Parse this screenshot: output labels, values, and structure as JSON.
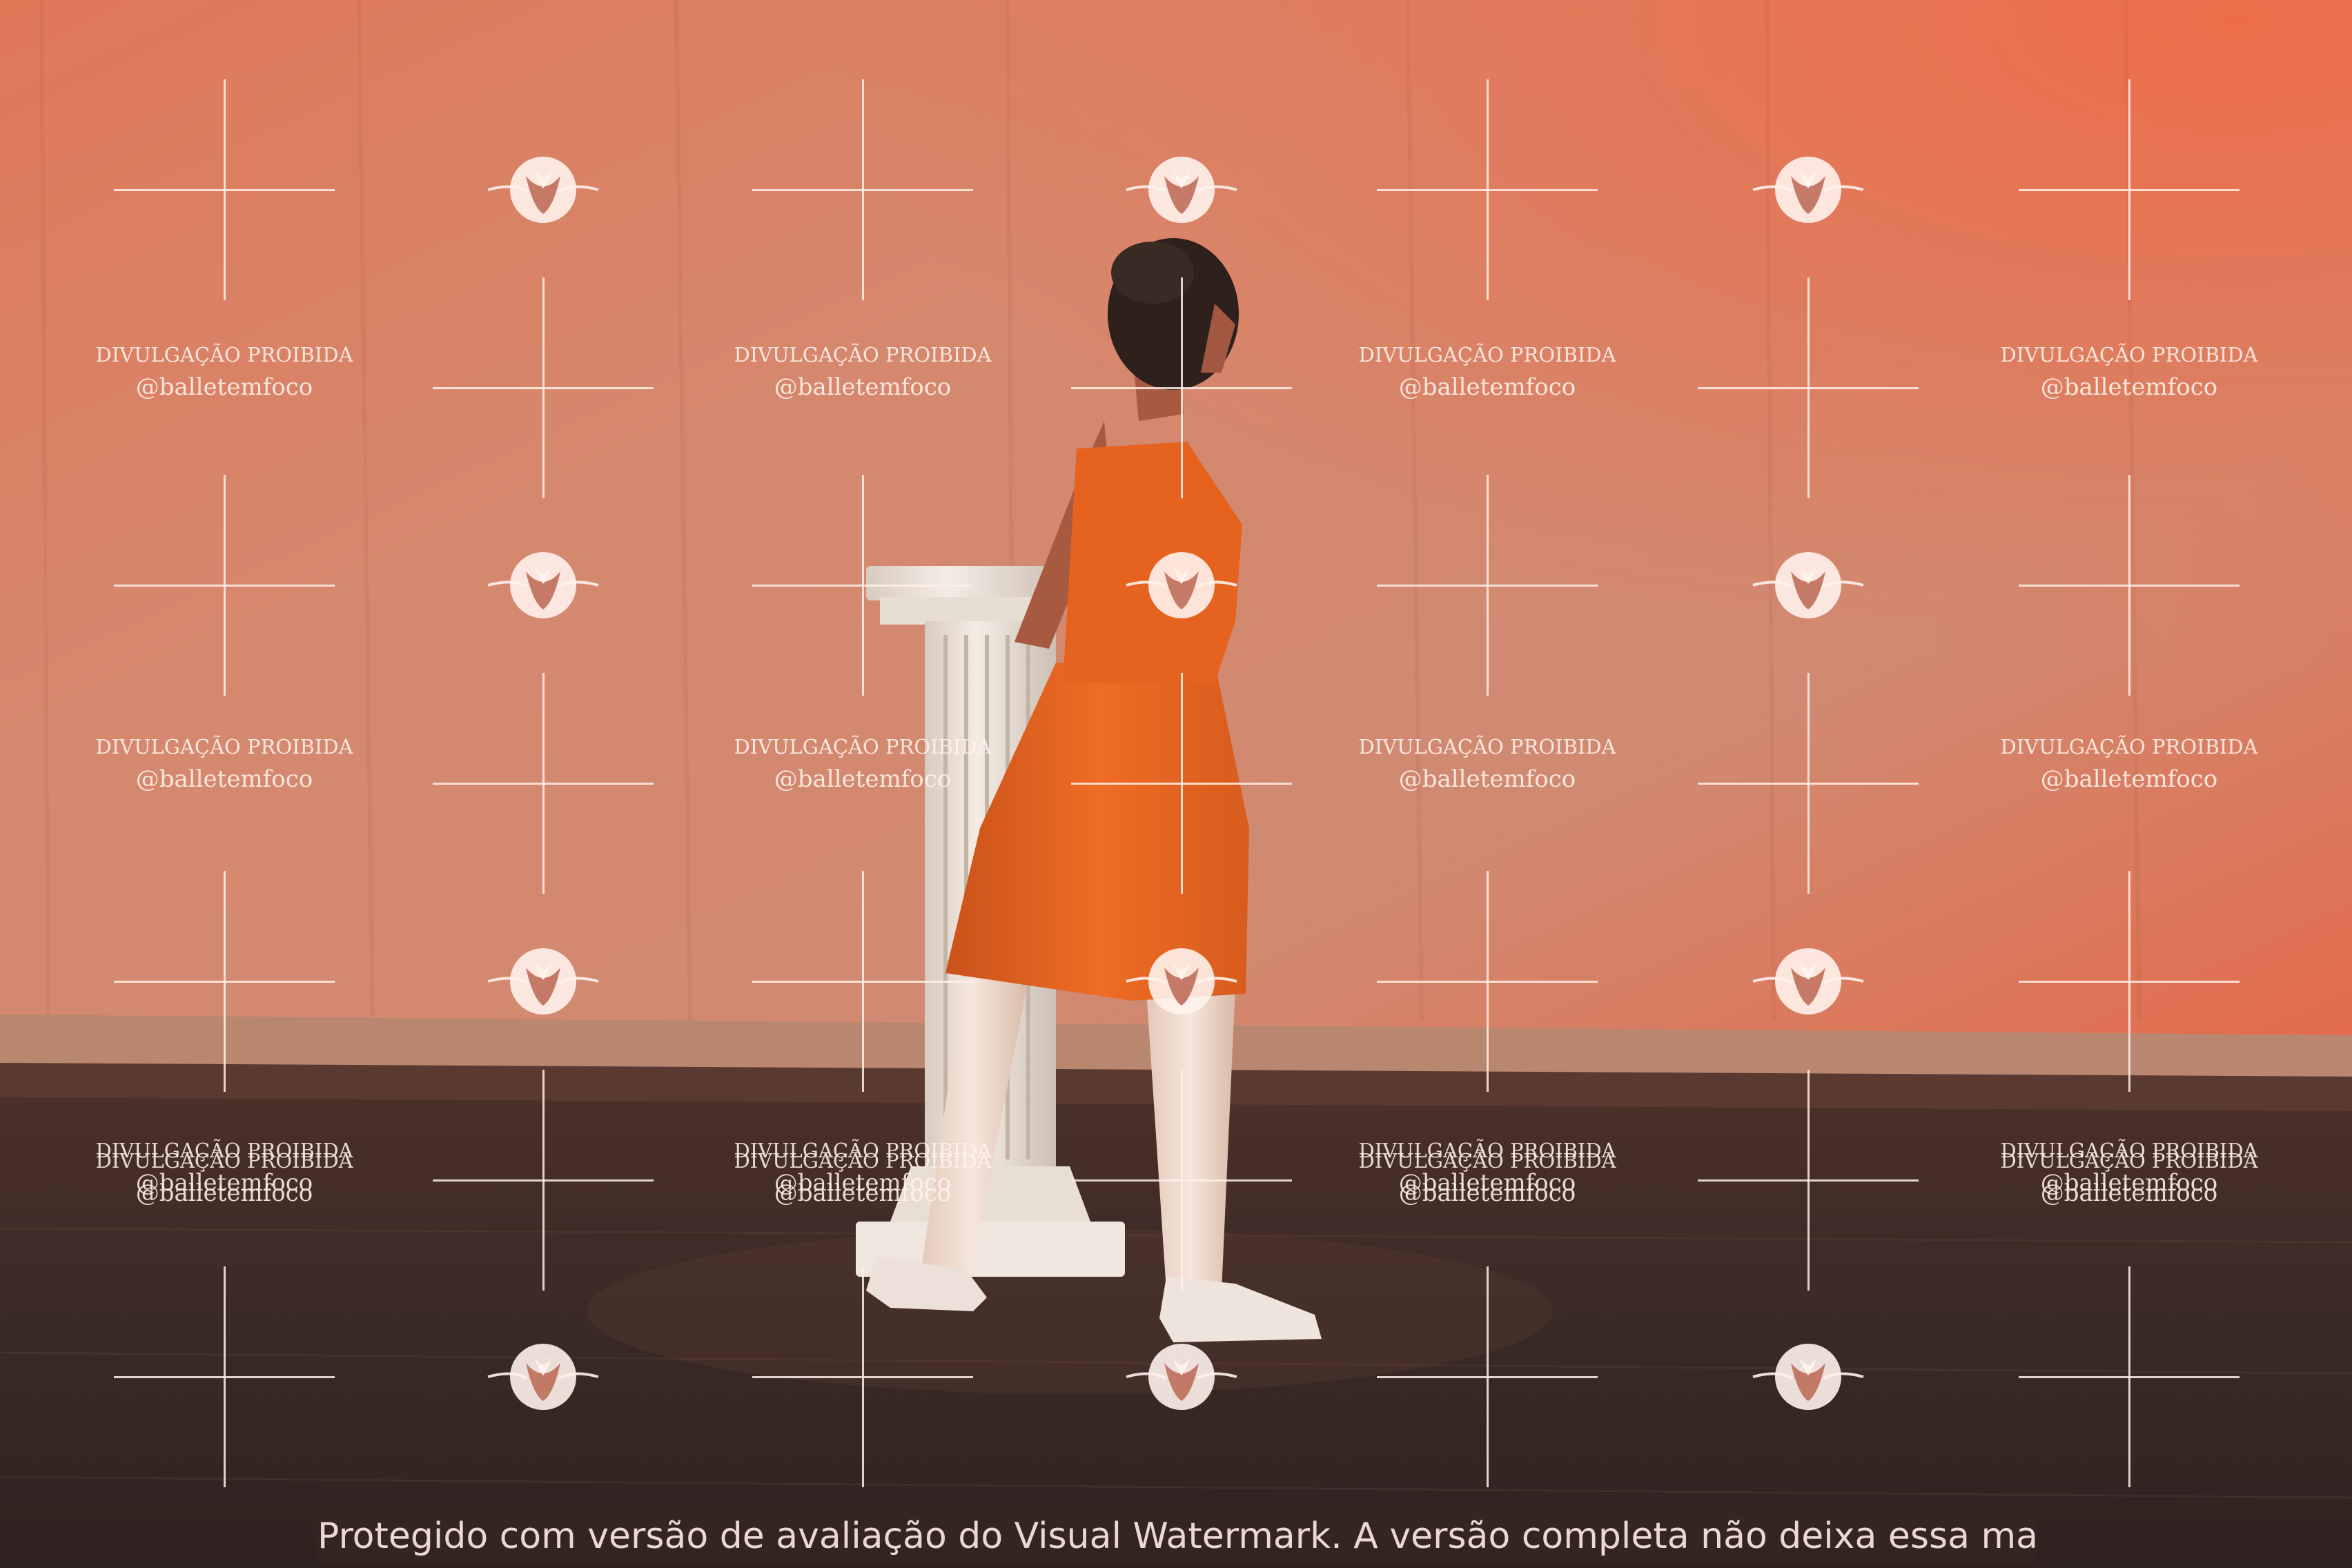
{
  "photo": {
    "subject": "ballet-dancer",
    "colors": {
      "backdrop_top": "#e0694a",
      "backdrop_mid": "#d8876c",
      "backdrop_low": "#c98f78",
      "stage_floor": "#3a2a24",
      "dress": "#e8641f",
      "column": "#efe6dd",
      "skin": "#b5694e",
      "tights": "#f1ddd0"
    }
  },
  "watermark": {
    "notice": "DIVULGAÇÃO PROIBIDA",
    "handle": "@balletemfoco",
    "logo_icon": "flower-camera-logo-icon",
    "cross_icon": "crosshair-icon"
  },
  "footer": {
    "banner_text": "Protegido com versão de avaliação do Visual Watermark. A versão completa não deixa essa marca."
  }
}
